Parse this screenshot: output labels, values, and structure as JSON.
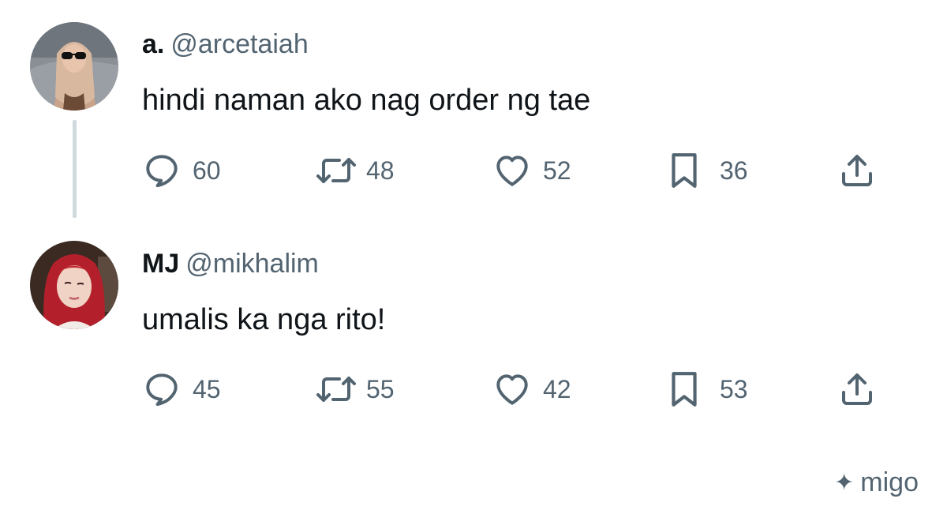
{
  "tweets": [
    {
      "name": "a.",
      "handle": "@arcetaiah",
      "text": "hindi naman ako nag order ng tae",
      "replies": "60",
      "retweets": "48",
      "likes": "52",
      "bookmarks": "36"
    },
    {
      "name": "MJ",
      "handle": "@mikhalim",
      "text": "umalis ka nga rito!",
      "replies": "45",
      "retweets": "55",
      "likes": "42",
      "bookmarks": "53"
    }
  ],
  "watermark": {
    "icon": "sparkle-icon",
    "label": "migo"
  },
  "icons": {
    "reply": "reply-icon",
    "retweet": "retweet-icon",
    "like": "heart-icon",
    "bookmark": "bookmark-icon",
    "share": "share-icon"
  },
  "colors": {
    "text": "#0f1419",
    "secondary": "#536471",
    "thread_line": "#cfd9de"
  }
}
